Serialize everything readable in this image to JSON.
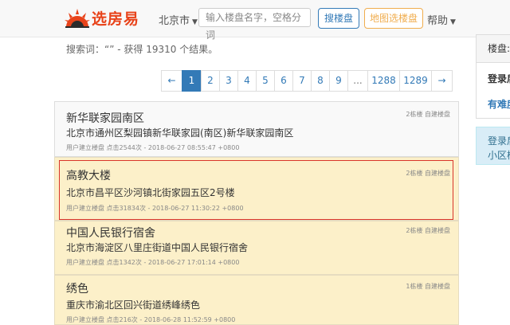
{
  "header": {
    "brand": "选房易",
    "city": "北京市",
    "search_placeholder": "输入楼盘名字，空格分词",
    "search_button": "搜楼盘",
    "map_button": "地图选楼盘",
    "help": "帮助",
    "brand_color": "#e8431a"
  },
  "summary": {
    "text": "搜索词：“” - 获得 19310 个结果。"
  },
  "pagination": {
    "prev": "←",
    "pages": [
      "1",
      "2",
      "3",
      "4",
      "5",
      "6",
      "7",
      "8",
      "9",
      "...",
      "1288",
      "1289"
    ],
    "next": "→",
    "active": "1"
  },
  "results": [
    {
      "title": "新华联家园南区",
      "address": "北京市通州区梨园镇新华联家园(南区)新华联家园南区",
      "meta": "用户建立楼盘 点击2544次 - 2018-06-27 08:55:47 +0800",
      "tag": "2栋楼 自建楼盘"
    },
    {
      "title": "高教大楼",
      "address": "北京市昌平区沙河镇北街家园五区2号楼",
      "meta": "用户建立楼盘 点击31834次 - 2018-06-27 11:30:22 +0800",
      "tag": "2栋楼 自建楼盘"
    },
    {
      "title": "中国人民银行宿舍",
      "address": "北京市海淀区八里庄街道中国人民银行宿舍",
      "meta": "用户建立楼盘 点击1342次 - 2018-06-27 17:01:14 +0800",
      "tag": "2栋楼 自建楼盘"
    },
    {
      "title": "绣色",
      "address": "重庆市渝北区回兴街道绣峰绣色",
      "meta": "用户建立楼盘 点击216次 - 2018-06-28 11:52:59 +0800",
      "tag": "1栋楼 自建楼盘"
    }
  ],
  "sidebar": {
    "panel_title": "楼盘:",
    "login": "登录后",
    "hard": "有难度",
    "info_line1": "登录后",
    "info_line2": "小区楼"
  }
}
